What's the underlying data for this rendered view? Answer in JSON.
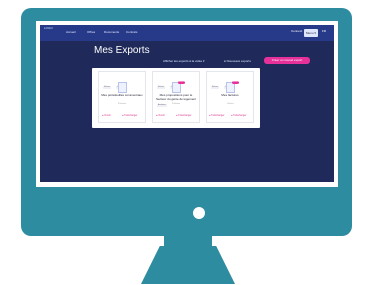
{
  "nav": {
    "logo": "LOGO",
    "links": [
      "Accueil",
      "Offres",
      "Documents",
      "Contrats"
    ],
    "button": "Connect",
    "user": "Menu ▾",
    "icon_label": "FR"
  },
  "page": {
    "title": "Mes Exports",
    "filter_label": "Afficher les exports à la volée ▾",
    "filter_label2": "● Nouveaux exports",
    "cta": "Créer un nouvel export"
  },
  "cards": [
    {
      "tabs": [
        "Fichier",
        "Historique"
      ],
      "badge": "",
      "title": "Mes portefeuilles commerciaux",
      "subtitle": "3 fichiers",
      "actions": [
        "● Ouvrir",
        "● Télécharger"
      ]
    },
    {
      "tabs": [
        "Fichier",
        "Historique",
        "Archives"
      ],
      "badge": "Nouveau",
      "title": "Mes propositions pour le Secteur du génie de logement",
      "subtitle": "2 fichiers",
      "actions": [
        "● Ouvrir",
        "● Télécharger"
      ]
    },
    {
      "tabs": [
        "Fichier",
        "Historique"
      ],
      "badge": "Nouveau",
      "title": "Mes factures",
      "subtitle": "1 fichier",
      "actions": [
        "● Télécharger",
        "● Télécharger"
      ]
    }
  ],
  "colors": {
    "frame": "#2e8ca0",
    "nav": "#273a8a",
    "screen": "#1f2a5a",
    "accent": "#e6319a"
  }
}
